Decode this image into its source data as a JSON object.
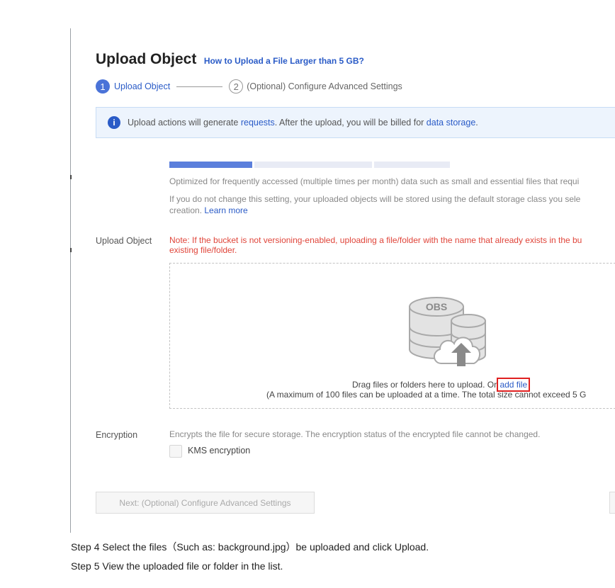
{
  "header": {
    "title": "Upload Object",
    "help_link": "How to Upload a File Larger than 5 GB?"
  },
  "wizard": {
    "steps": [
      {
        "number": "1",
        "label": "Upload Object"
      },
      {
        "number": "2",
        "label": "(Optional) Configure Advanced Settings"
      }
    ]
  },
  "info_bar": {
    "icon": "i",
    "text_1": "Upload actions will generate ",
    "link_1": "requests",
    "text_2": ". After the upload, you will be billed for ",
    "link_2": "data storage",
    "text_3": "."
  },
  "storage_class": {
    "description": "Optimized for frequently accessed (multiple times per month) data such as small and essential files that requi",
    "default_note_1": "If you do not change this setting, your uploaded objects will be stored using the default storage class you sele",
    "default_note_2": "creation. ",
    "learn_more": "Learn more"
  },
  "upload_section": {
    "label": "Upload Object",
    "warning_1": "Note: If the bucket is not versioning-enabled, uploading a file/folder with the name that already exists in the bu",
    "warning_2": "existing file/folder.",
    "graphic_text": "OBS",
    "drag_text": "Drag files or folders here to upload. Or ",
    "add_file": "add file",
    "max_text": "(A maximum of 100 files can be uploaded at a time. The total size cannot exceed 5 G"
  },
  "encryption": {
    "label": "Encryption",
    "description": "Encrypts the file for secure storage. The encryption status of the encrypted file cannot be changed.",
    "kms_label": "KMS encryption"
  },
  "footer": {
    "next_button": "Next: (Optional) Configure Advanced Settings"
  },
  "instructions": {
    "step4": "Step 4 Select the files（Such as: background.jpg）be uploaded and click Upload.",
    "step5": "Step 5 View the uploaded file or folder in the list."
  },
  "colors": {
    "accent": "#2a5bc7",
    "active_step": "#4a73d8",
    "warning": "#e0453a",
    "info_bg": "#edf4fd",
    "highlight_box": "#e02020"
  }
}
